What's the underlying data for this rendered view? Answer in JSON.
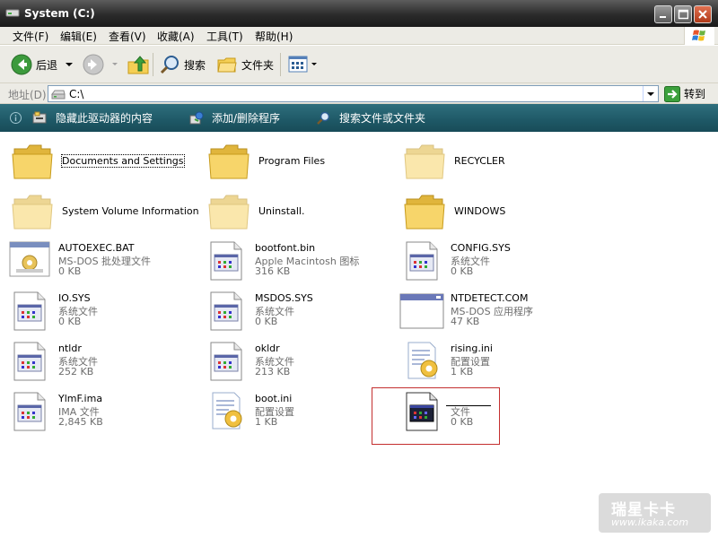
{
  "window": {
    "title": "System (C:)"
  },
  "menu": [
    {
      "id": "file",
      "label": "文件(F)"
    },
    {
      "id": "edit",
      "label": "编辑(E)"
    },
    {
      "id": "view",
      "label": "查看(V)"
    },
    {
      "id": "favorites",
      "label": "收藏(A)"
    },
    {
      "id": "tools",
      "label": "工具(T)"
    },
    {
      "id": "help",
      "label": "帮助(H)"
    }
  ],
  "toolbar": {
    "back_label": "后退",
    "search_label": "搜索",
    "folders_label": "文件夹"
  },
  "address": {
    "label": "地址(D)",
    "value": "C:\\",
    "go_label": "转到"
  },
  "tasks": {
    "hide_contents": "隐藏此驱动器的内容",
    "add_remove": "添加/删除程序",
    "search_files": "搜索文件或文件夹"
  },
  "items": [
    {
      "name": "Documents and Settings",
      "type": "folder"
    },
    {
      "name": "Program Files",
      "type": "folder"
    },
    {
      "name": "RECYCLER",
      "type": "folder"
    },
    {
      "name": "System Volume Information",
      "type": "folder"
    },
    {
      "name": "Uninstall.",
      "type": "folder"
    },
    {
      "name": "WINDOWS",
      "type": "folder"
    },
    {
      "name": "AUTOEXEC.BAT",
      "kind": "MS-DOS 批处理文件",
      "size": "0 KB",
      "type": "batch"
    },
    {
      "name": "bootfont.bin",
      "kind": "Apple Macintosh 图标",
      "size": "316 KB",
      "type": "file"
    },
    {
      "name": "CONFIG.SYS",
      "kind": "系统文件",
      "size": "0 KB",
      "type": "file"
    },
    {
      "name": "IO.SYS",
      "kind": "系统文件",
      "size": "0 KB",
      "type": "file"
    },
    {
      "name": "MSDOS.SYS",
      "kind": "系统文件",
      "size": "0 KB",
      "type": "file"
    },
    {
      "name": "NTDETECT.COM",
      "kind": "MS-DOS 应用程序",
      "size": "47 KB",
      "type": "app"
    },
    {
      "name": "ntldr",
      "kind": "系统文件",
      "size": "252 KB",
      "type": "file"
    },
    {
      "name": "okldr",
      "kind": "系统文件",
      "size": "213 KB",
      "type": "file"
    },
    {
      "name": "rising.ini",
      "kind": "配置设置",
      "size": "1 KB",
      "type": "ini"
    },
    {
      "name": "YlmF.ima",
      "kind": "IMA 文件",
      "size": "2,845 KB",
      "type": "file"
    },
    {
      "name": "boot.ini",
      "kind": "配置设置",
      "size": "1 KB",
      "type": "ini"
    },
    {
      "name": "",
      "kind": "文件",
      "size": "0 KB",
      "type": "file-dark"
    }
  ],
  "watermark": {
    "brand": "瑞星卡卡",
    "url": "www.ikaka.com"
  },
  "colors": {
    "title_bar": "#2b2b2b",
    "task_bar": "#1e5866",
    "highlight_box": "#c42f2f",
    "folder_yellow": "#f5cf55"
  }
}
